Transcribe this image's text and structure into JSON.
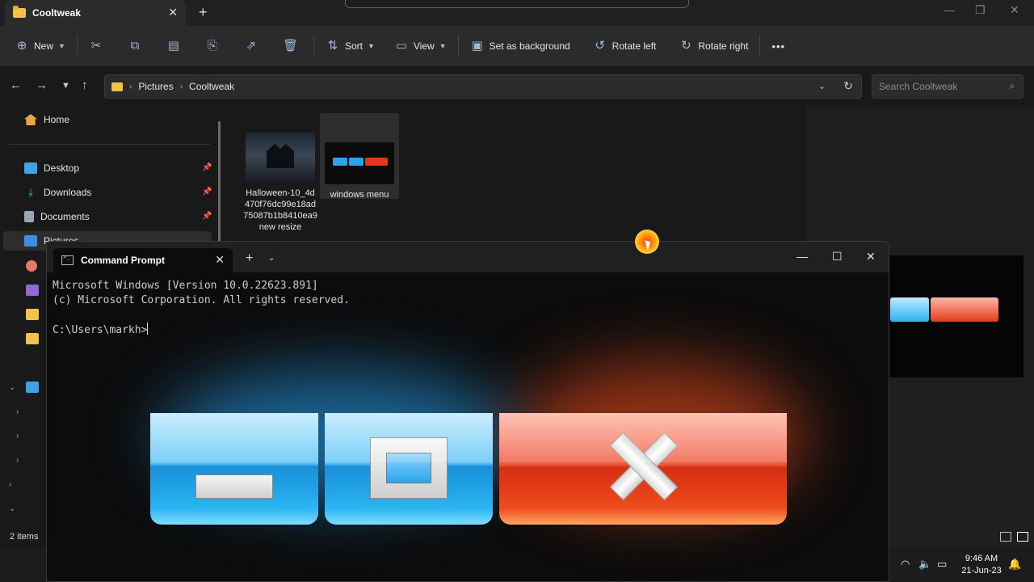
{
  "explorer": {
    "tab_title": "Cooltweak",
    "toolbar": {
      "new_label": "New",
      "sort_label": "Sort",
      "view_label": "View",
      "set_background_label": "Set as background",
      "rotate_left_label": "Rotate left",
      "rotate_right_label": "Rotate right",
      "more_label": "•••"
    },
    "breadcrumb": [
      "Pictures",
      "Cooltweak"
    ],
    "search_placeholder": "Search Cooltweak",
    "sidebar": {
      "home": "Home",
      "desktop": "Desktop",
      "downloads": "Downloads",
      "documents": "Documents",
      "pictures": "Pictures"
    },
    "files": [
      {
        "name": "Halloween-10_4d470f76dc99e18ad75087b1b8410ea9 new resize",
        "lines": [
          "Halloween-10_4d",
          "470f76dc99e18ad",
          "75087b1b8410ea9",
          "new resize"
        ]
      },
      {
        "name": "windows menu"
      }
    ],
    "status": "2 items",
    "colors": {
      "folder": "#f2c34b",
      "accent": "#9fb8d8"
    }
  },
  "cmd": {
    "title": "Command Prompt",
    "lines": [
      "Microsoft Windows [Version 10.0.22623.891]",
      "(c) Microsoft Corporation. All rights reserved.",
      "",
      "C:\\Users\\markh>"
    ]
  },
  "tray": {
    "time": "9:46 AM",
    "date": "21-Jun-23"
  }
}
